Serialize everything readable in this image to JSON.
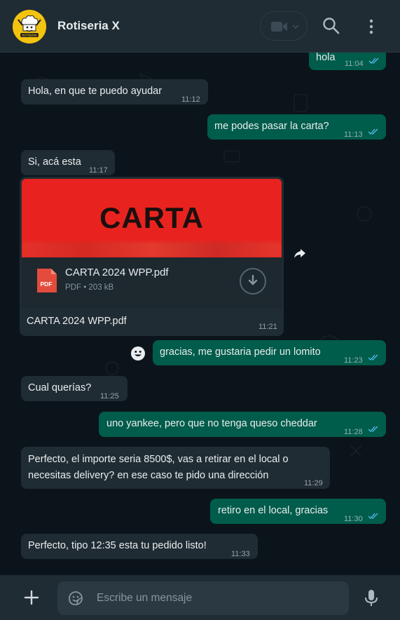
{
  "header": {
    "contact_name": "Rotiseria X",
    "avatar_text": "ROTISERIA"
  },
  "messages": [
    {
      "direction": "out",
      "text": "hola",
      "time": "11:04",
      "read": true
    },
    {
      "direction": "in",
      "text": "Hola, en que te puedo ayudar",
      "time": "11:12"
    },
    {
      "direction": "out",
      "text": "me podes pasar la carta?",
      "time": "11:13",
      "read": true
    },
    {
      "direction": "in",
      "text": "Si, acá esta",
      "time": "11:17"
    },
    {
      "direction": "out",
      "text": "gracias, me gustaria pedir un lomito",
      "time": "11:23",
      "read": true
    },
    {
      "direction": "in",
      "text": "Cual querías?",
      "time": "11:25"
    },
    {
      "direction": "out",
      "text": "uno yankee, pero que no tenga queso cheddar",
      "time": "11:28",
      "read": true
    },
    {
      "direction": "in",
      "text_line1": "Perfecto, el importe seria 8500$, vas a retirar en el local o",
      "text_line2": "necesitas delivery? en ese caso te pido una dirección",
      "time": "11:29"
    },
    {
      "direction": "out",
      "text": "retiro en el local, gracias",
      "time": "11:30",
      "read": true
    },
    {
      "direction": "in",
      "text": "Perfecto, tipo 12:35 esta tu pedido listo!",
      "time": "11:33"
    }
  ],
  "document": {
    "preview_title": "CARTA",
    "file_name": "CARTA 2024 WPP.pdf",
    "file_type_badge": "PDF",
    "meta": "PDF • 203 kB",
    "caption": "CARTA  2024 WPP.pdf",
    "time": "11:21"
  },
  "composer": {
    "placeholder": "Escribe un mensaje"
  },
  "icons": [
    "video-call-icon",
    "chevron-down-icon",
    "search-icon",
    "menu-icon",
    "forward-icon",
    "emoji-reaction-icon",
    "pdf-icon",
    "download-icon",
    "plus-icon",
    "sticker-icon",
    "mic-icon"
  ],
  "colors": {
    "header_bg": "#202c33",
    "chat_bg": "#0b141a",
    "incoming_bubble": "#202c33",
    "outgoing_bubble": "#005c4b",
    "read_ticks": "#53bdeb",
    "carta_preview": "#e8231f",
    "avatar_bg": "#f2c30f"
  }
}
